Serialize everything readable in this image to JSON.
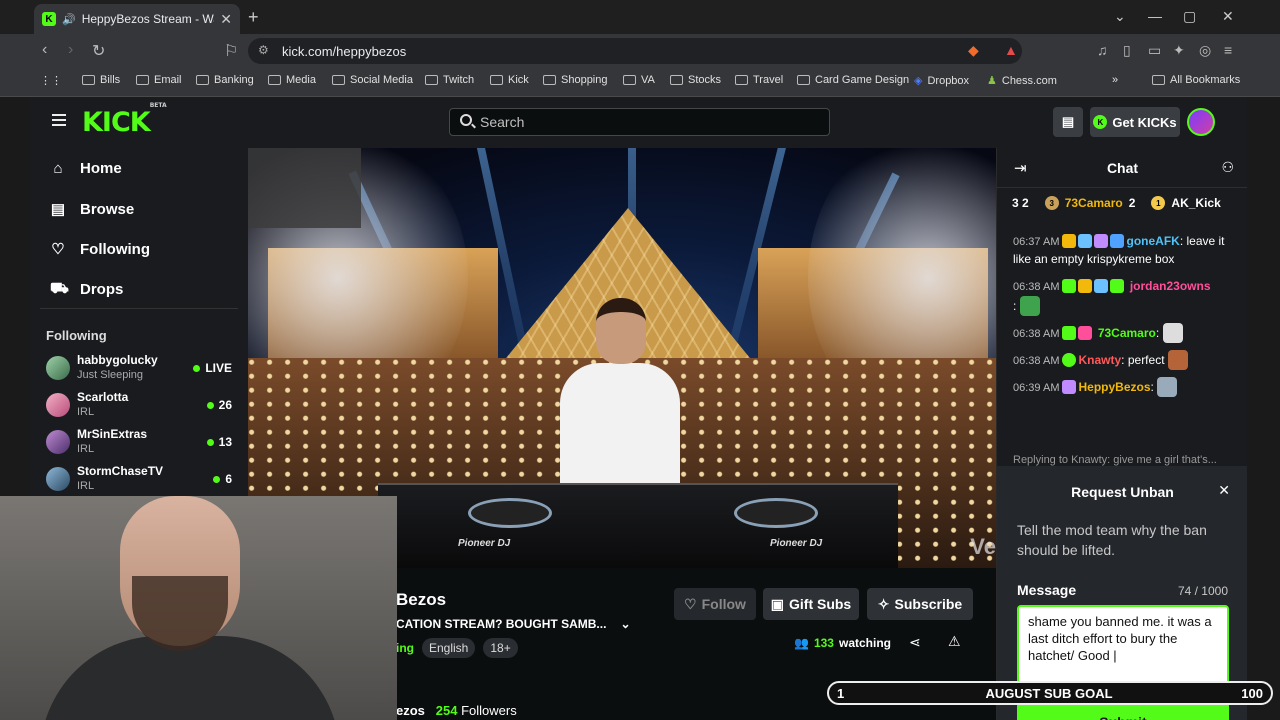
{
  "browser": {
    "tab_title": "HeppyBezos Stream - Watch",
    "url": "kick.com/heppybezos",
    "bookmarks": [
      "Bills",
      "Email",
      "Banking",
      "Media",
      "Social Media",
      "Twitch",
      "Kick",
      "Shopping",
      "VA",
      "Stocks",
      "Travel",
      "Card Game Design",
      "Dropbox",
      "Chess.com"
    ],
    "all_bookmarks": "All Bookmarks"
  },
  "header": {
    "logo": "KICK",
    "logo_sup": "BETA",
    "search_placeholder": "Search",
    "get_kicks": "Get KICKs"
  },
  "sidebar": {
    "nav": [
      {
        "label": "Home",
        "icon": "home-icon"
      },
      {
        "label": "Browse",
        "icon": "browse-icon"
      },
      {
        "label": "Following",
        "icon": "heart-icon"
      },
      {
        "label": "Drops",
        "icon": "drops-icon"
      }
    ],
    "following_title": "Following",
    "following": [
      {
        "name": "habbygolucky",
        "category": "Just Sleeping",
        "count": "LIVE"
      },
      {
        "name": "Scarlotta",
        "category": "IRL",
        "count": "26"
      },
      {
        "name": "MrSinExtras",
        "category": "IRL",
        "count": "13"
      },
      {
        "name": "StormChaseTV",
        "category": "IRL",
        "count": "6"
      }
    ]
  },
  "video": {
    "watermark": "Ve",
    "brand": "Pioneer DJ"
  },
  "stream": {
    "name": "Bezos",
    "title": "CATION STREAM? BOUGHT SAMB...",
    "tag_prefix": "ing",
    "tags": [
      "English",
      "18+"
    ],
    "follow": "Follow",
    "gift_subs": "Gift Subs",
    "subscribe": "Subscribe",
    "watching_count": "133",
    "watching_label": "watching",
    "followers_name": "ezos",
    "followers_count": "254",
    "followers_label": "Followers"
  },
  "chat": {
    "title": "Chat",
    "gifters": [
      {
        "name": "",
        "count": "3 2"
      },
      {
        "name": "73Camaro",
        "count": "2"
      },
      {
        "name": "AK_Kick",
        "count": ""
      }
    ],
    "messages": [
      {
        "time": "06:37 AM",
        "user": "goneAFK",
        "color": "#4fc3f7",
        "text": "leave it like an empty krispykreme box"
      },
      {
        "time": "06:38 AM",
        "user": "jordan23owns",
        "color": "#ff4f9a",
        "text": ":"
      },
      {
        "time": "06:38 AM",
        "user": "73Camaro",
        "color": "#53fc18",
        "text": ":"
      },
      {
        "time": "06:38 AM",
        "user": "Knawty",
        "color": "#ff5a5a",
        "text": ": perfect"
      },
      {
        "time": "06:39 AM",
        "user": "HeppyBezos",
        "color": "#f2b80c",
        "text": ":"
      }
    ],
    "reply_preview": "Replying to Knawty: give me a girl that's..."
  },
  "unban": {
    "title": "Request Unban",
    "description": "Tell the mod team why the ban should be lifted.",
    "message_label": "Message",
    "char_count": "74 / 1000",
    "message_value": "shame you banned me. it was a last ditch effort to bury the hatchet/ Good |",
    "submit": "Submit"
  },
  "sub_goal": {
    "left": "1",
    "label": "AUGUST SUB GOAL",
    "right": "100"
  },
  "colors": {
    "accent": "#53fc18",
    "bg": "#0b0e0f",
    "panel": "#191b1f"
  }
}
